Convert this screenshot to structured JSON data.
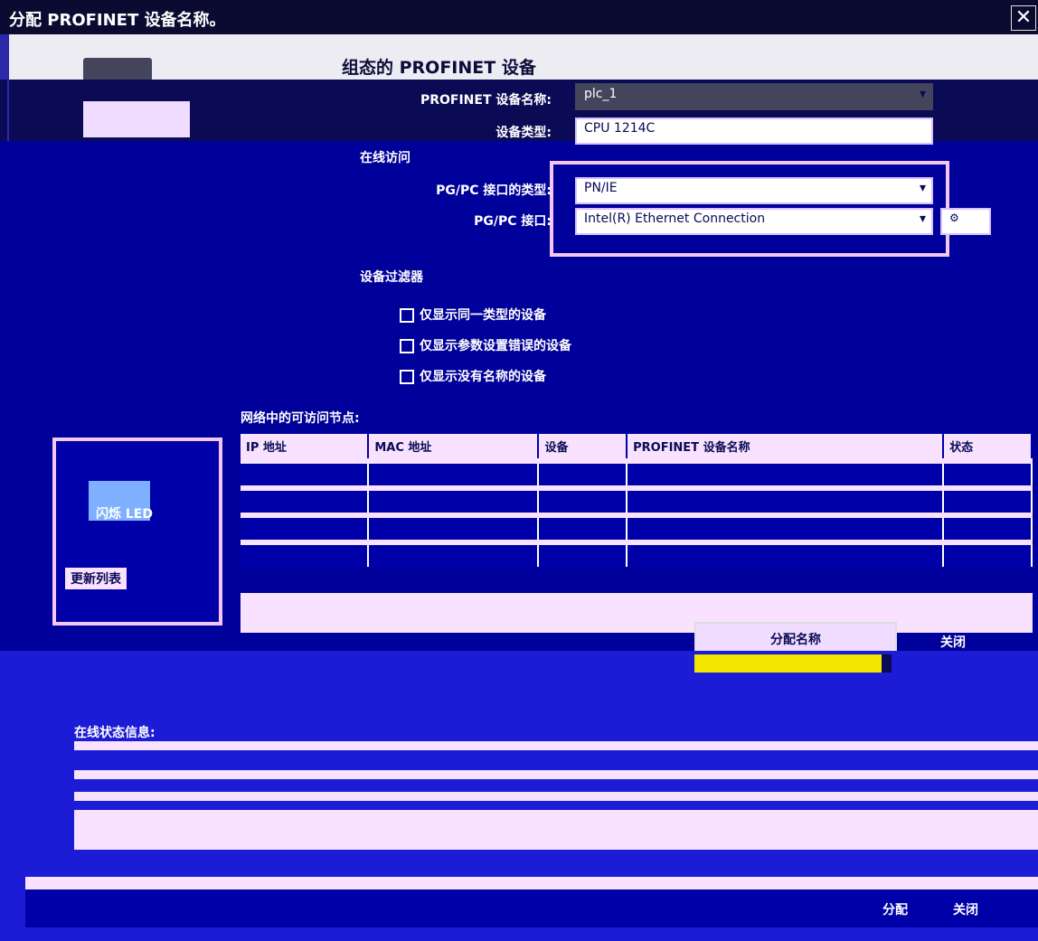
{
  "window": {
    "title": "分配 PROFINET 设备名称。",
    "close_label": "✕"
  },
  "header": {
    "title": "组态的 PROFINET 设备"
  },
  "config": {
    "device_name_label": "PROFINET 设备名称:",
    "device_name_value": "plc_1",
    "device_type_label": "设备类型:",
    "device_type_value": "CPU 1214C",
    "online_access_label": "在线访问",
    "interface_type_label": "PG/PC 接口的类型:",
    "interface_type_value": "PN/IE",
    "interface_label": "PG/PC 接口:",
    "interface_value": "Intel(R) Ethernet Connection"
  },
  "filters": {
    "title": "设备过滤器",
    "items": [
      "仅显示同一类型的设备",
      "仅显示参数设置错误的设备",
      "仅显示没有名称的设备"
    ]
  },
  "table": {
    "title": "网络中的可访问节点:",
    "headers": [
      "IP 地址",
      "MAC 地址",
      "设备",
      "PROFINET 设备名称",
      "状态"
    ],
    "rows": [
      [
        "",
        "",
        "",
        "",
        ""
      ],
      [
        "",
        "",
        "",
        "",
        ""
      ],
      [
        "",
        "",
        "",
        "",
        ""
      ],
      [
        "",
        "",
        "",
        "",
        ""
      ],
      [
        "",
        "",
        "",
        "",
        ""
      ]
    ]
  },
  "side": {
    "flash_led_label": "闪烁 LED",
    "update_label": "更新列表"
  },
  "actions": {
    "assign_name_label": "分配名称",
    "close_label": "关闭",
    "progress": 0.95
  },
  "online_status": {
    "title": "在线状态信息:",
    "rows": [
      "",
      "",
      ""
    ]
  },
  "footer": {
    "assign_label": "分配",
    "close_label": "关闭"
  }
}
